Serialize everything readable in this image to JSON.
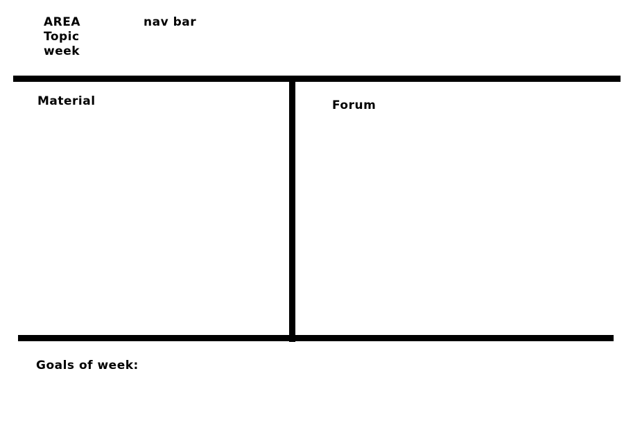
{
  "header": {
    "area_label": "AREA",
    "topic_label": "Topic",
    "week_label": "week",
    "nav_label": "nav bar"
  },
  "panels": {
    "material_title": "Material",
    "forum_title": "Forum"
  },
  "footer": {
    "goals_label": "Goals of week:"
  },
  "colors": {
    "background": "#ffffff",
    "ink": "#000000"
  }
}
